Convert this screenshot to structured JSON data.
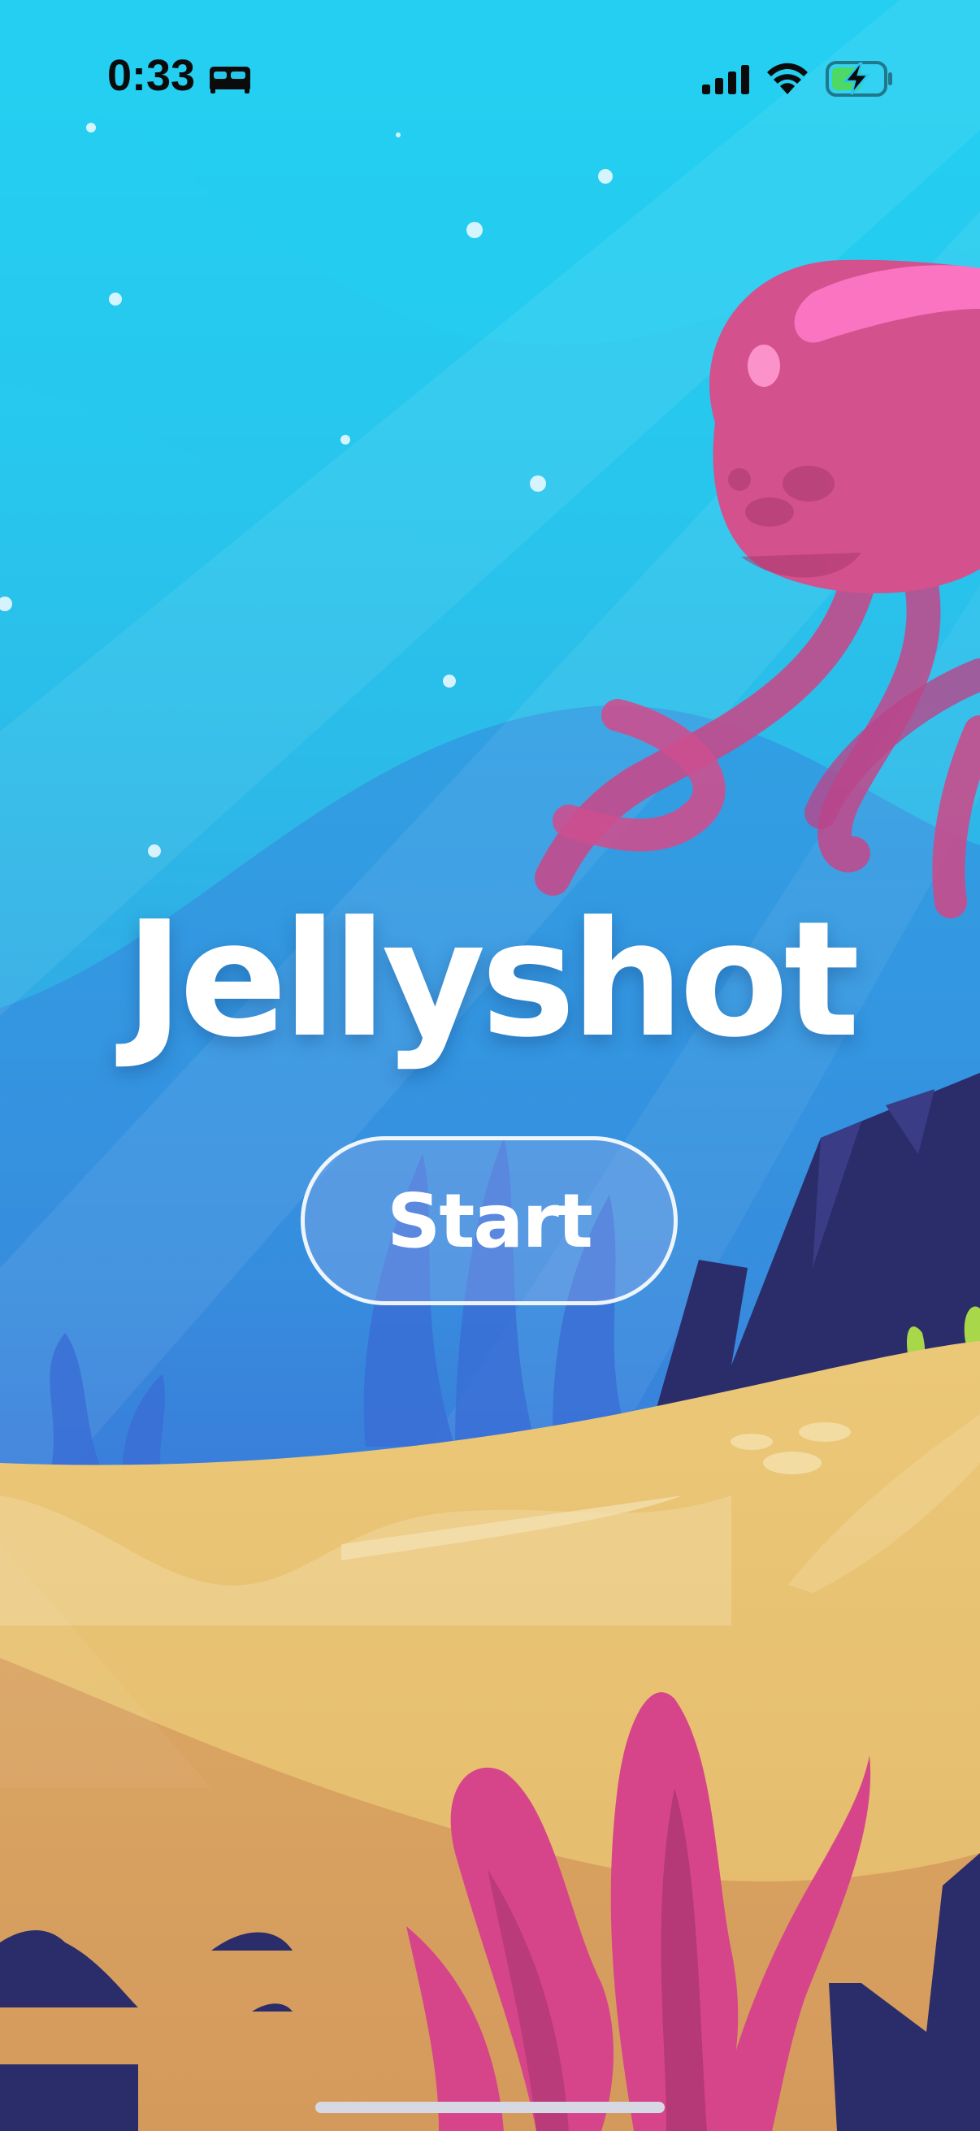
{
  "status_bar": {
    "time": "0:33",
    "focus_icon": "bed-icon",
    "signal_icon": "cellular-signal-icon",
    "wifi_icon": "wifi-icon",
    "battery_icon": "battery-charging-icon"
  },
  "game": {
    "title": "Jellyshot",
    "start_label": "Start"
  },
  "colors": {
    "sky_top": "#22d8f4",
    "sky_bottom": "#3c62d8",
    "jellyfish": "#d64d8d",
    "sand_light": "#e9c777",
    "sand_dark": "#d9a35f",
    "rock": "#2b2d6b",
    "seaweed": "#d6458a",
    "battery_green": "#4cd964"
  }
}
